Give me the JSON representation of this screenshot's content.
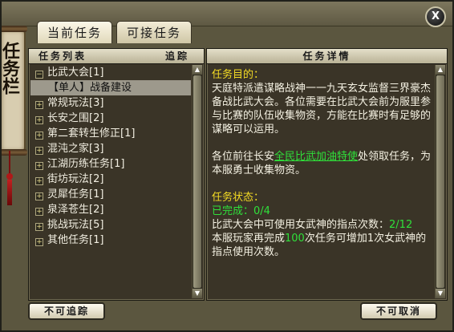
{
  "window": {
    "close_label": "X",
    "side_title": "任务栏"
  },
  "tabs": [
    {
      "label": "当前任务",
      "active": true
    },
    {
      "label": "可接任务",
      "active": false
    }
  ],
  "list_panel": {
    "header_title": "任务列表",
    "header_track": "追踪",
    "items": [
      {
        "icon": "minus-icon",
        "label": "比武大会[1]",
        "expanded": true
      },
      {
        "icon": "",
        "label": "【单人】战备建设",
        "selected": true,
        "sub": true
      },
      {
        "icon": "plus-icon",
        "label": "常规玩法[3]"
      },
      {
        "icon": "plus-icon",
        "label": "长安之围[2]"
      },
      {
        "icon": "plus-icon",
        "label": "第二套转生修正[1]"
      },
      {
        "icon": "plus-icon",
        "label": "混沌之家[3]"
      },
      {
        "icon": "plus-icon",
        "label": "江湖历练任务[1]"
      },
      {
        "icon": "plus-icon",
        "label": "街坊玩法[2]"
      },
      {
        "icon": "plus-icon",
        "label": "灵犀任务[1]"
      },
      {
        "icon": "plus-icon",
        "label": "泉泽苍生[2]"
      },
      {
        "icon": "plus-icon",
        "label": "挑战玩法[5]"
      },
      {
        "icon": "plus-icon",
        "label": "其他任务[1]"
      }
    ],
    "untrack_button": "不可追踪"
  },
  "detail_panel": {
    "header_title": "任务详情",
    "goal_heading": "任务目的：",
    "goal_text": "天庭特派遣谋略战神一一九天玄女监督三界豪杰备战比武大会。各位需要在比武大会前为服里参与比赛的队伍收集物资，方能在比赛时有足够的谋略可以运用。",
    "visit_prefix": "各位前往长安",
    "visit_npc": "全民比武加油特使",
    "visit_suffix": "处领取任务，为本服勇士收集物资。",
    "status_heading": "任务状态：",
    "status_done": "已完成：0/4",
    "status_line1": "比武大会中可使用女武神的指点次数：",
    "status_count": "2/12",
    "bonus_prefix": "本服玩家再完成",
    "bonus_number": "100",
    "bonus_suffix": "次任务可增加1次女武神的指点使用次数。",
    "cancel_button": "不可取消"
  },
  "colors": {
    "highlight_yellow": "#f5dc24",
    "highlight_green": "#2fe03a",
    "panel_bg": "#3a3427"
  }
}
